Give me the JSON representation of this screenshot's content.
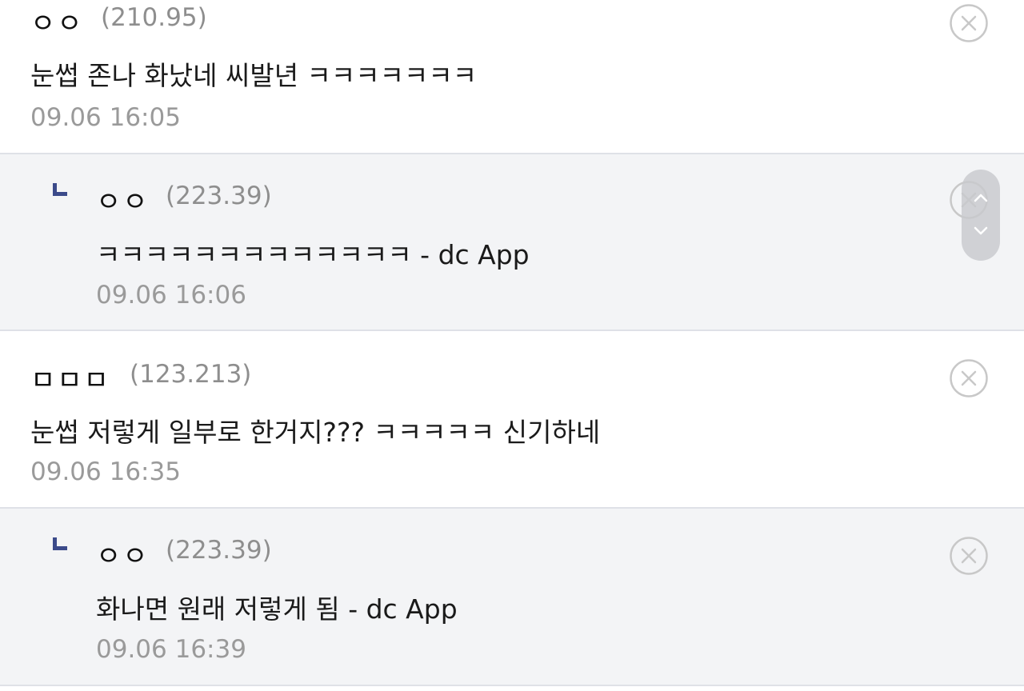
{
  "comments": [
    {
      "author": "ㅇㅇ",
      "ip": "(210.95)",
      "text": "눈썹 존나 화났네 씨발년 ㅋㅋㅋㅋㅋㅋㅋ",
      "timestamp": "09.06 16:05",
      "is_reply": false
    },
    {
      "author": "ㅇㅇ",
      "ip": "(223.39)",
      "text": "ㅋㅋㅋㅋㅋㅋㅋㅋㅋㅋㅋㅋㅋ - dc App",
      "timestamp": "09.06 16:06",
      "is_reply": true
    },
    {
      "author": "ㅁㅁㅁ",
      "ip": "(123.213)",
      "text": "눈썹 저렇게 일부로 한거지??? ㅋㅋㅋㅋㅋ 신기하네",
      "timestamp": "09.06 16:35",
      "is_reply": false
    },
    {
      "author": "ㅇㅇ",
      "ip": "(223.39)",
      "text": "화나면 원래 저렇게 됨 - dc App",
      "timestamp": "09.06 16:39",
      "is_reply": true
    }
  ],
  "icons": {
    "delete": "close-circle-icon",
    "reply_marker": "reply-arrow-icon",
    "scroll_up": "chevron-up-icon",
    "scroll_down": "chevron-down-icon"
  },
  "colors": {
    "reply_background": "#f3f4f6",
    "reply_marker": "#3b4a8a",
    "divider": "#dfe1e7",
    "ip_text": "#8e8e8e",
    "timestamp_text": "#9a9a9a"
  }
}
